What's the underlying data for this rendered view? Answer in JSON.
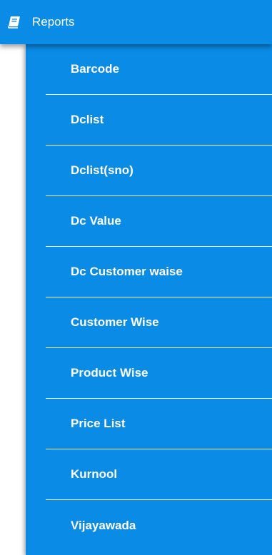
{
  "menu": {
    "header_label": "Reports",
    "header_icon": "book-icon",
    "accent_color": "#0a8be6",
    "items": [
      {
        "label": "Barcode"
      },
      {
        "label": "Dclist"
      },
      {
        "label": "Dclist(sno)"
      },
      {
        "label": "Dc Value"
      },
      {
        "label": "Dc Customer waise"
      },
      {
        "label": "Customer Wise"
      },
      {
        "label": "Product Wise"
      },
      {
        "label": "Price List"
      },
      {
        "label": "Kurnool"
      },
      {
        "label": "Vijayawada"
      }
    ]
  }
}
